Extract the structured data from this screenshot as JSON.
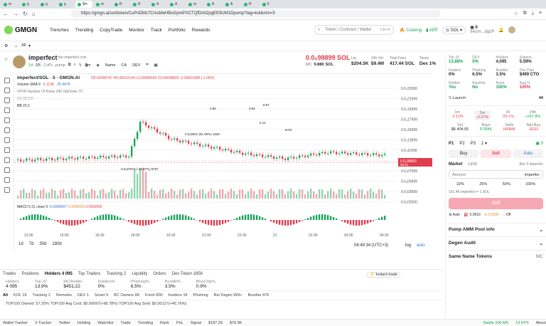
{
  "browser": {
    "tabs": [
      "m",
      "g",
      "g",
      "g",
      "$m",
      "m",
      "R",
      "R",
      "A",
      "A",
      "m",
      "A",
      "A",
      "R",
      "fi"
    ],
    "url": "https://gmgn.ai/sol/token/CuPnDMz7CmsMeHBoGpmPXCTQfDmt2pgEE9UM1Dpump?tag=kol&min=5"
  },
  "header": {
    "brand": "GMGN",
    "nav": [
      "Trenches",
      "Trending",
      "CopyTrade",
      "Monitor",
      "Track",
      "Portfolio",
      "Rewards"
    ],
    "search_placeholder": "Token / Contract / Wallet",
    "search_shortcut": "Ctrl+K",
    "cooking": "Cooking",
    "app": "APP",
    "chain": "SOL",
    "balance": "0",
    "wallet": "9Acm...dgcP"
  },
  "subbar": {
    "menu": "All"
  },
  "token": {
    "name": "imperfect",
    "subtitle": "the imperfect coin",
    "age": "1d",
    "holders_badge": "D5",
    "ca": "CuPr...pump",
    "price": "0.0₅98899 SOL",
    "mc_label": "MC",
    "mc": "9.88K SOL",
    "liq_label": "Liq",
    "liq": "$204.5K",
    "vol_label": "24h Vol",
    "vol": "$9.4M",
    "fees_label": "Total Fees",
    "fees": "417.44 SOL",
    "taxes_label": "Taxes",
    "taxes": "Dex 1%"
  },
  "chart_toolbar": {
    "interval": "5m",
    "items": [
      "Name",
      "CA",
      "DEV"
    ]
  },
  "chart": {
    "pair": "imperfect/SOL · 5 · GMGN.AI",
    "ohlc": "O0.00099747 H0.00010144 L0.00098559 C0.00098683 -0.00001688 (-1.06%)",
    "volume_label": "Volume SMA 9",
    "volume_vals": [
      "5.113K",
      "25.447K"
    ],
    "vrvp_label": "VPVR Number Of Rows 240 Up/Down 70",
    "xc_label": "XC 15 0.9",
    "bb_label": "BB 20 2",
    "macd_label": "MACD 5 21 close 9",
    "macd_vals": [
      "-0.0000007",
      "0.0000009",
      "0.0000006"
    ],
    "y_ticks": [
      "0.0₃22000",
      "0.0₃21999",
      "0.0₃19999",
      "0.0₃17999",
      "0.0₃15999",
      "0.0₃13999",
      "0.0₃11999",
      "0.0₃09999",
      "0.0₃07999",
      "0.0₃05999",
      "0.0₃03999",
      "0.0₃02000"
    ],
    "x_ticks": [
      "13:30",
      "15:00",
      "16:30",
      "18:00",
      "19:30",
      "21:00",
      "22:30",
      "21",
      "01:30",
      "03:00",
      "04:30"
    ],
    "current_price_tag": "0.0₅98683",
    "countdown": "08:21",
    "annotations": [
      "0.0₅87972 (-46.97%) 8797",
      "0.0₅8801 (51.39%) 1630",
      "4.85",
      "3.94",
      "8.97",
      "6.13",
      "-9.03"
    ],
    "clock": "04:49:34 (UTC+3)",
    "ranges": [
      "1d",
      "7d",
      "30d",
      "180d"
    ],
    "log": "log",
    "auto": "auto"
  },
  "bottom": {
    "tabs": [
      "Trades",
      "Positions",
      "Holders 4 095",
      "Top Traders",
      "Tracking 2",
      "Liquidity",
      "Orders",
      "Dev Token 1858"
    ],
    "instant_trade": "Instant trade",
    "stats": [
      {
        "label": "Holders",
        "value": "4 095"
      },
      {
        "label": "Top 10",
        "value": "13.9%"
      },
      {
        "label": "MC/Holder",
        "value": "$451,22"
      },
      {
        "label": "Insiders%",
        "value": "0%"
      },
      {
        "label": "Phishing%",
        "value": "6.5%"
      },
      {
        "label": "Bundle%",
        "value": "3.5%"
      },
      {
        "label": "BlueChip%",
        "value": "0.9%"
      }
    ],
    "filters": [
      "All",
      "KOL 19",
      "Tracking 2",
      "Remarks",
      "DEV 1",
      "Smart 9",
      "BC Owners 88",
      "Fresh 800",
      "Insiders 18",
      "Phishing",
      "Bot Degen 999+",
      "Bundler 476"
    ],
    "top100": "TOP100 Owned: 57.25%   TOP100 Avg Cost: $0.00097(+98.78%)   TOP100 Avg Sold: $0.00127(+45.76%)"
  },
  "right": {
    "stats": [
      {
        "label": "Top 10",
        "value": "13.88%",
        "color": "green"
      },
      {
        "label": "DEV",
        "value": "0%",
        "color": "green"
      },
      {
        "label": "Holders",
        "value": "4,095",
        "color": "dark"
      },
      {
        "label": "Snipers",
        "value": "5.59%",
        "color": "dark"
      },
      {
        "label": "Insiders",
        "value": "0%",
        "color": "dark"
      },
      {
        "label": "Phishing",
        "value": "6.5%",
        "color": "dark"
      },
      {
        "label": "Bundler",
        "value": "3.5%",
        "color": "dark"
      },
      {
        "label": "Dex Paid",
        "value": "$499 CTO",
        "color": "dark"
      },
      {
        "label": "NoMint",
        "value": "Yes",
        "color": "green"
      },
      {
        "label": "Blacklist",
        "value": "No",
        "color": "green"
      },
      {
        "label": "Burnt",
        "value": "100%",
        "color": "green"
      },
      {
        "label": "Rug %",
        "value": "100%",
        "color": "red"
      }
    ],
    "launch": "Launch",
    "launch_count": "44",
    "periods": [
      {
        "label": "1m",
        "value": "-2.11%",
        "color": "red"
      },
      {
        "label": "5m",
        "value": "-0.37%",
        "color": "red"
      },
      {
        "label": "1h",
        "value": "-20.1%",
        "color": "red"
      },
      {
        "label": "24h",
        "value": "+247.8%",
        "color": "green"
      }
    ],
    "volrow": [
      {
        "label": "Vol",
        "value": "$8 404,05"
      },
      {
        "label": "Buys",
        "value": "57/$4K"
      },
      {
        "label": "Sells",
        "value": "66/$4K"
      },
      {
        "label": "Net Buy",
        "value": "-$162"
      }
    ],
    "presets": [
      "P1",
      "P2",
      "P3"
    ],
    "preset_num": "1",
    "zero": "0",
    "buy": "Buy",
    "sell": "Sell",
    "auto": "Auto",
    "market": "Market",
    "limit": "Limit",
    "bal": "Bal: 0 imperfec",
    "amount": "Amount",
    "amount_unit": "imperfec",
    "pcts": [
      "10%",
      "25%",
      "50%",
      "100%"
    ],
    "rate": "101.4K imperfect = 1 SOL",
    "sell_btn": "Sell",
    "fees": [
      "Auto",
      "0.0019",
      "0.0035",
      "Off"
    ],
    "sections": [
      "Pump AMM Pool info",
      "Degen Audit",
      "Same Name Tokens"
    ],
    "mc": "MC"
  },
  "statusbar": {
    "items": [
      "Wallet Tracker",
      "X Tracker",
      "Twitter",
      "Holding",
      "Watchlist",
      "Trade",
      "Trending",
      "Rank",
      "PnL",
      "Signal",
      "$187.29",
      "$76.9K"
    ],
    "stable": "Stable 106 MS",
    "fps": "13 FPS",
    "about": "About"
  }
}
